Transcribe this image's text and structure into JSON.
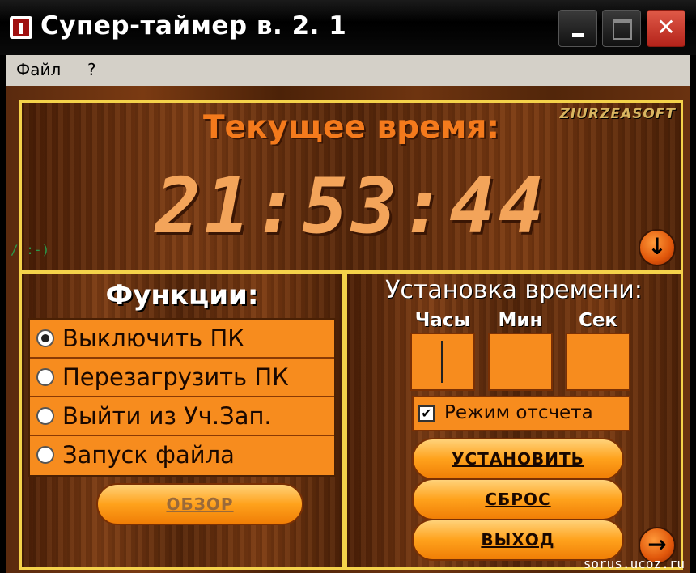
{
  "window": {
    "title": "Супер-таймер в. 2. 1",
    "controls": {
      "minimize": "minimize",
      "maximize": "maximize",
      "close": "close"
    }
  },
  "menu": {
    "file": "Файл",
    "help": "?"
  },
  "clock_panel": {
    "heading": "Текущее время:",
    "brand": "ZIURZEASOFT",
    "time": "21:53:44",
    "toggle_icon": "↓"
  },
  "functions_panel": {
    "heading": "Функции:",
    "options": [
      {
        "label": "Выключить ПК",
        "checked": true
      },
      {
        "label": "Перезагрузить ПК",
        "checked": false
      },
      {
        "label": "Выйти из Уч.Зап.",
        "checked": false
      },
      {
        "label": "Запуск файла",
        "checked": false
      }
    ],
    "browse_label": "ОБЗОР"
  },
  "time_panel": {
    "heading": "Установка времени:",
    "hours_label": "Часы",
    "minutes_label": "Мин",
    "seconds_label": "Сек",
    "hours_value": "",
    "minutes_value": "",
    "seconds_value": "",
    "countdown_label": "Режим отсчета",
    "countdown_checked": true,
    "set_label": "УСТАНОВИТЬ",
    "reset_label": "СБРОС",
    "exit_label": "ВЫХОД",
    "next_icon": "→"
  },
  "overlays": {
    "smile": "/ :-)",
    "watermark": "sorus.ucoz.ru"
  },
  "colors": {
    "accent_orange": "#f78c1e",
    "frame_yellow": "#f4d24a",
    "heading_orange": "#f47a1c",
    "close_red": "#c8301f"
  }
}
